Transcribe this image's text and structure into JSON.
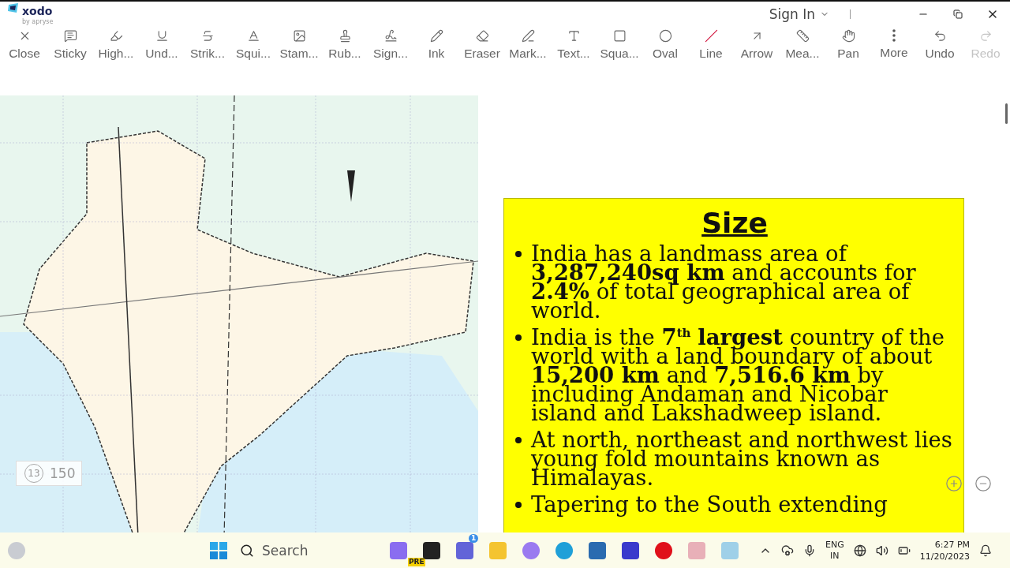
{
  "app": {
    "name": "xodo",
    "byline": "by apryse"
  },
  "account": {
    "label": "Sign In"
  },
  "tools": [
    {
      "label": "Close",
      "disabled": false
    },
    {
      "label": "Sticky",
      "disabled": false
    },
    {
      "label": "High...",
      "disabled": false
    },
    {
      "label": "Und...",
      "disabled": false
    },
    {
      "label": "Strik...",
      "disabled": false
    },
    {
      "label": "Squi...",
      "disabled": false
    },
    {
      "label": "Stam...",
      "disabled": false
    },
    {
      "label": "Rub...",
      "disabled": false
    },
    {
      "label": "Sign...",
      "disabled": false
    },
    {
      "label": "Ink",
      "disabled": false
    },
    {
      "label": "Eraser",
      "disabled": false
    },
    {
      "label": "Mark...",
      "disabled": false
    },
    {
      "label": "Text...",
      "disabled": false
    },
    {
      "label": "Squa...",
      "disabled": false
    },
    {
      "label": "Oval",
      "disabled": false
    },
    {
      "label": "Line",
      "disabled": false
    },
    {
      "label": "Arrow",
      "disabled": false
    },
    {
      "label": "Mea...",
      "disabled": false
    },
    {
      "label": "Pan",
      "disabled": false
    },
    {
      "label": "More",
      "disabled": false
    },
    {
      "label": "Undo",
      "disabled": false
    },
    {
      "label": "Redo",
      "disabled": true
    }
  ],
  "document": {
    "slide": {
      "title": "Size",
      "bullets": [
        "India has a landmass area of **3,287,240sq km** and accounts for **2.4%** of total geographical area of world.",
        "India is the **7**$^{th}$ **largest** country of the world with a land boundary of about **15,200 km** and **7,516.6 km** by including Andaman and Nicobar island and Lakshadweep island.",
        "At north, northeast and northwest lies young fold mountains known as Himalayas.",
        "Tapering to the South extending"
      ]
    }
  },
  "page_indicator": {
    "current": "13",
    "total": "150"
  },
  "taskbar": {
    "search": {
      "placeholder": "Search"
    },
    "copilot_badge": "PRE",
    "chat_badge": "1",
    "language": "ENG",
    "region": "IN",
    "time": "6:27 PM",
    "date": "11/20/2023"
  }
}
